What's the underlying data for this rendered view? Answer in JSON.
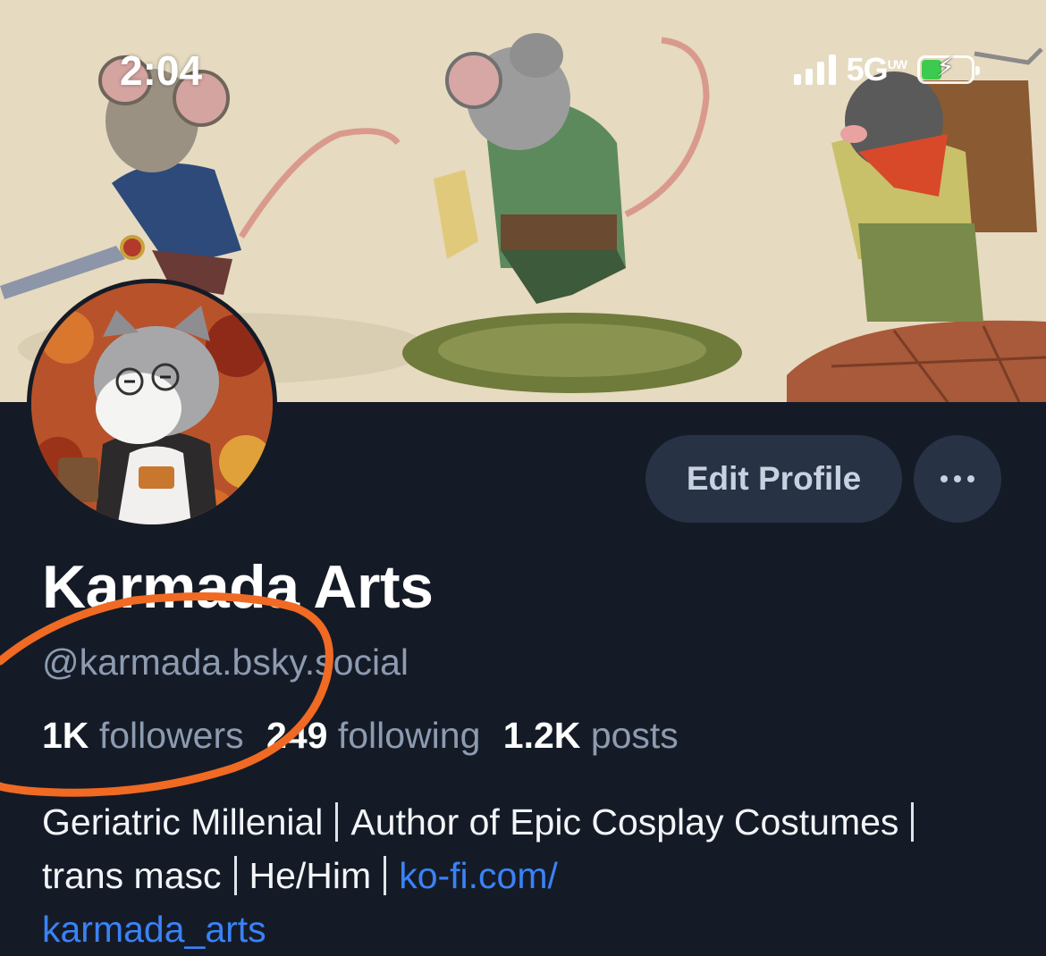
{
  "status_bar": {
    "time": "2:04",
    "network": "5G",
    "network_suffix": "UW",
    "battery_charging": true
  },
  "profile": {
    "display_name": "Karmada Arts",
    "handle": "@karmada.bsky.social",
    "stats": [
      {
        "count": "1K",
        "label": "followers"
      },
      {
        "count": "249",
        "label": "following"
      },
      {
        "count": "1.2K",
        "label": "posts"
      }
    ],
    "bio": {
      "segments": [
        "Geriatric Millenial",
        "Author of Epic Cosplay Costumes",
        "trans masc",
        "He/Him"
      ],
      "link_line1": "ko-fi.com/",
      "link_line2": "karmada_arts"
    }
  },
  "actions": {
    "edit_label": "Edit Profile",
    "more_icon": "ellipsis-icon"
  },
  "colors": {
    "background": "#151b26",
    "button_bg": "#273245",
    "muted_text": "#8d9bb1",
    "link": "#3a82f7",
    "annotation": "#f06a23"
  }
}
